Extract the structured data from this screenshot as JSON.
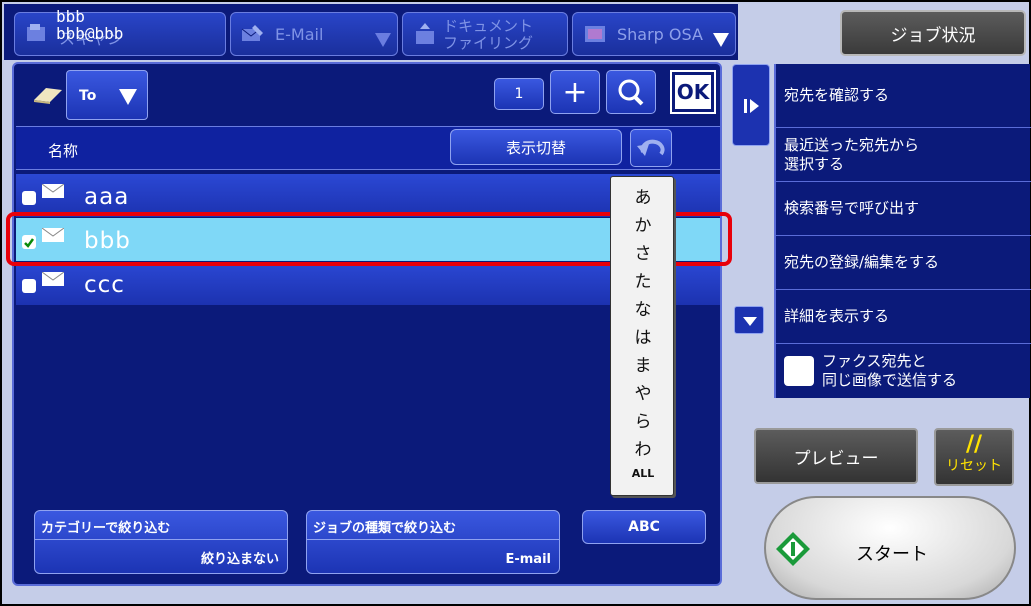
{
  "top_tabs": {
    "scan_label": "スキャン",
    "email_label": "E-Mail",
    "doc_label_1": "ドキュメント",
    "doc_label_2": "ファイリング",
    "osa_label": "Sharp OSA"
  },
  "address_display": {
    "name": "bbb",
    "address": "bbb@bbb"
  },
  "job_status_label": "ジョブ状況",
  "toolbar": {
    "to_label": "To",
    "count": "1",
    "ok_label": "OK"
  },
  "list_header": {
    "name_label": "名称",
    "toggle_label": "表示切替"
  },
  "entries": [
    {
      "name": "aaa",
      "selected": false
    },
    {
      "name": "bbb",
      "selected": true
    },
    {
      "name": "ccc",
      "selected": false
    }
  ],
  "kana_index": [
    "あ",
    "か",
    "さ",
    "た",
    "な",
    "は",
    "ま",
    "や",
    "ら",
    "わ",
    "ALL"
  ],
  "filters": {
    "category_label": "カテゴリーで絞り込む",
    "category_value": "絞り込まない",
    "jobtype_label": "ジョブの種類で絞り込む",
    "jobtype_value": "E-mail",
    "abc_label": "ABC"
  },
  "actions": {
    "confirm": "宛先を確認する",
    "recent_1": "最近送った宛先から",
    "recent_2": "選択する",
    "search_no": "検索番号で呼び出す",
    "register": "宛先の登録/編集をする",
    "details": "詳細を表示する",
    "fax_same_1": "ファクス宛先と",
    "fax_same_2": "同じ画像で送信する"
  },
  "bottom": {
    "preview_label": "プレビュー",
    "reset_symbol": "//",
    "reset_label": "リセット",
    "start_label": "スタート"
  },
  "colors": {
    "panel": "#0b1a7a",
    "row": "#2b48d4",
    "selected_row": "#7fd8f7",
    "highlight": "#e8000a",
    "reset_text": "#ffe300"
  }
}
